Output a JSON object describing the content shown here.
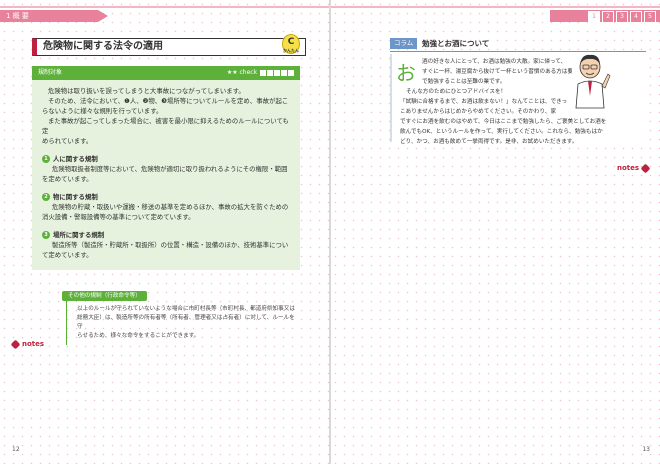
{
  "header": {
    "chapter_label": "1 概 要",
    "chapter_tabs": [
      "1",
      "2",
      "3",
      "4",
      "5"
    ]
  },
  "left_page": {
    "title": "危険物に関する法令の適用",
    "level_badge": "C",
    "level_small": "かんたん",
    "rule_box": {
      "label": "規制対象",
      "check_label": "★★ check",
      "intro_lines": [
        "危険物は取り扱いを誤ってしまうと大事故につながってしまいます。",
        "そのため、法令において、❶人、❷物、❸場所等についてルールを定め、事故が起こ",
        "らないように様々な規則を行っています。",
        "また事故が起こってしまった場合に、被害を最小限に抑えるためのルールについても定",
        "められています。"
      ],
      "sections": [
        {
          "num": "1",
          "title": "人に関する規制",
          "body": [
            "危険物取扱者制度等において、危険物が適切に取り扱われるようにその権限・範囲",
            "を定めています。"
          ]
        },
        {
          "num": "2",
          "title": "物に関する規制",
          "body": [
            "危険物の貯蔵・取扱いや運搬・移送の基準を定めるほか、事故の拡大を防ぐための",
            "消火設備・警報設備等の基準について定めています。"
          ]
        },
        {
          "num": "3",
          "title": "場所に関する規制",
          "body": [
            "製造所等（製造所・貯蔵所・取扱所）の位置・構造・設備のほか、技術基準につい",
            "て定めています。"
          ]
        }
      ]
    },
    "other_rule": {
      "label": "その他の規制（行政命令等）",
      "lines": [
        "以上のルールが守られていないような場合に市町村長等（市町村長、都道府県知事又は",
        "総務大臣）は、製造所等の所有者等（所有者、管理者又は占有者）に対して、ルールを守",
        "らせるため、様々な命令をすることができます。"
      ]
    },
    "notes_label": "notes",
    "page_number": "12"
  },
  "right_page": {
    "column_label": "コラム",
    "column_title": "勉強とお酒について",
    "initial": "お",
    "column_lines": [
      "酒の好きな人にとって、お酒は勉強の大敵。家に帰って、",
      "すぐに一杯、湯豆腐から抜けて一杯という習慣のある方は要",
      "で勉強することは至難の業です。",
      "そんな方のためにひとつアドバイスを！",
      "「試験に合格するまで、お酒は飲まない！」なんてことは、できっ",
      "こありませんからはじめからやめてください。そのかわり、家",
      "ですぐにお酒を飲むのはやめて、今日はここまで勉強したら、ご褒美としてお酒を",
      "飲んでもOK、というルールを作って、実行してください。これなら、勉強もはか",
      "どり、かつ、お酒も飲めて一挙両得です。是非、お試めいただきます。"
    ],
    "notes_label": "notes",
    "page_number": "13"
  },
  "colors": {
    "accent": "#e8819b",
    "green": "#5db13b",
    "blue": "#6c95c9"
  }
}
